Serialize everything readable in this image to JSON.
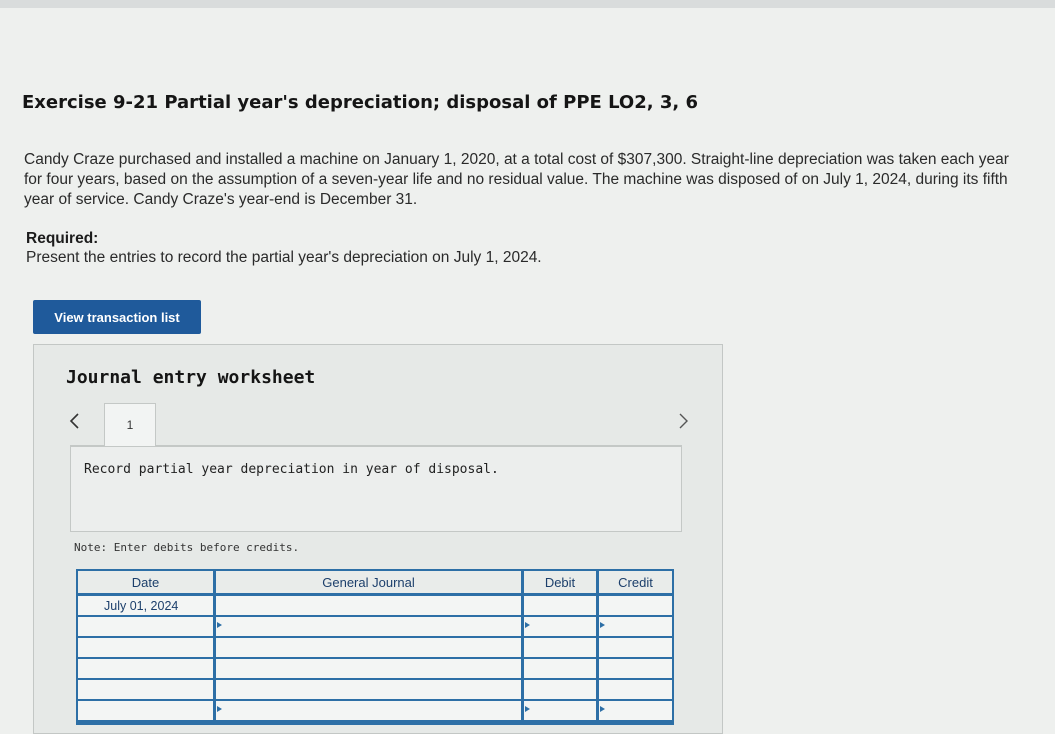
{
  "exercise": {
    "title": "Exercise 9-21 Partial year's depreciation; disposal of PPE LO2, 3, 6",
    "intro": "Candy Craze purchased and installed a machine on January 1, 2020, at a total cost of $307,300. Straight-line depreciation was taken each year for four years, based on the assumption of a seven-year life and no residual value. The machine was disposed of on July 1, 2024, during its fifth year of service. Candy Craze's year-end is December 31.",
    "required_label": "Required:",
    "required_text": "Present the entries to record the partial year's depreciation on July 1, 2024."
  },
  "buttons": {
    "view_transactions": "View transaction list"
  },
  "worksheet": {
    "title": "Journal entry worksheet",
    "tabs": [
      "1"
    ],
    "instruction": "Record partial year depreciation in year of disposal.",
    "note": "Note: Enter debits before credits."
  },
  "journal": {
    "headers": [
      "Date",
      "General Journal",
      "Debit",
      "Credit"
    ],
    "rows": [
      {
        "date": "July 01, 2024",
        "account": "",
        "debit": "",
        "credit": ""
      },
      {
        "date": "",
        "account": "",
        "debit": "",
        "credit": ""
      },
      {
        "date": "",
        "account": "",
        "debit": "",
        "credit": ""
      },
      {
        "date": "",
        "account": "",
        "debit": "",
        "credit": ""
      },
      {
        "date": "",
        "account": "",
        "debit": "",
        "credit": ""
      },
      {
        "date": "",
        "account": "",
        "debit": "",
        "credit": ""
      }
    ]
  },
  "colors": {
    "primary_button": "#1f5a9b",
    "table_grid": "#2d6fa6",
    "header_text": "#1c3f6b"
  }
}
